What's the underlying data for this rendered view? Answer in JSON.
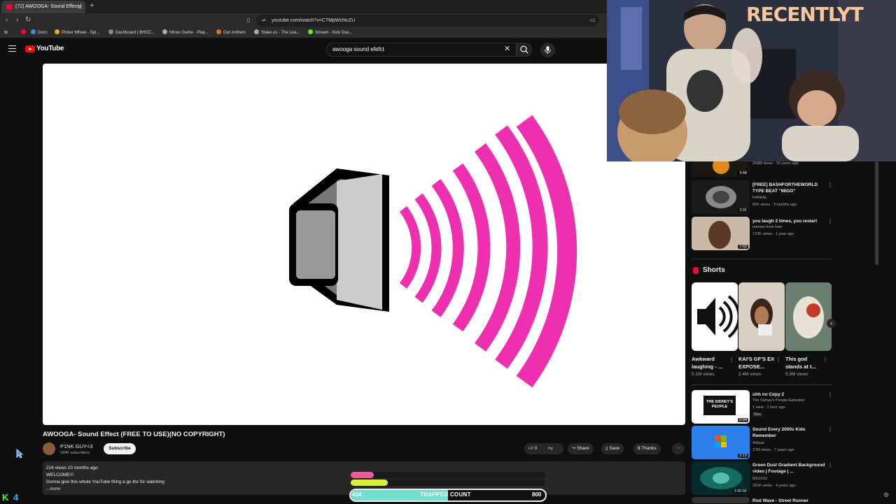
{
  "browser": {
    "tab_title": "(72) AWOOGA- Sound Effect (",
    "url": "youtube.com/watch?v=CTMpWchicZU",
    "bookmarks": [
      "Docs",
      "Picker Wheel - Spi...",
      "Dashboard | BHCC...",
      "Mines Game - Play...",
      "Our Anthem",
      "Stake.us - The Lea...",
      "Stream - Kick Gas..."
    ]
  },
  "youtube": {
    "logo_text": "YouTube",
    "search_value": "awooga sound efefct"
  },
  "video": {
    "title": "AWOOGA- Sound Effect (FREE TO USE)(NO COPYRIGHT)",
    "channel": "P1NK GUY<3",
    "subscribers": "184K subscribers",
    "subscribe_label": "Subscribe",
    "likes": "0",
    "share_label": "Share",
    "save_label": "Save",
    "thanks_label": "Thanks",
    "description": {
      "stats": "216 views  10 months ago",
      "line1": "WELCOME!!!",
      "line2": "Gonna give this whole YouTube thing a go thx for watching",
      "more": "...more"
    }
  },
  "overlay": {
    "brand_text": "RECENTLYT",
    "trapped_left": "414",
    "trapped_label": "TRAPPED COUNT",
    "trapped_right": "800",
    "bar1_fraction": 0.12,
    "bar2_fraction": 0.19,
    "trapped_fraction": 0.5
  },
  "sidebar": {
    "videos": [
      {
        "title": "",
        "meta1": "269M views · 10 years ago",
        "meta2": "",
        "duration": "3:48"
      },
      {
        "title": "[FREE] BASHFORTHEWORLD TYPE BEAT \"MIGO\"",
        "meta1": "K4REAL",
        "meta2": "65K views · 3 months ago",
        "duration": "2:31"
      },
      {
        "title": "you laugh 2 times, you restart",
        "meta1": "memes from hole",
        "meta2": "170K views · 1 year ago",
        "duration": "7:03"
      }
    ],
    "shorts_heading": "Shorts",
    "shorts": [
      {
        "title": "Awkward laughing - ...",
        "views": "5.1M views"
      },
      {
        "title": "KAI'S GF'S EX EXPOSE...",
        "views": "2.4M views"
      },
      {
        "title": "This god stands at t...",
        "views": "5.9M views"
      }
    ],
    "more_videos": [
      {
        "title": "uhh no   Copy 2",
        "meta1": "The Sidney's People Episodes",
        "meta2": "1 view · 1 hour ago",
        "badge": "New",
        "duration": "0:04"
      },
      {
        "title": "Sound Every 2000s Kids Remember",
        "meta1": "Artisax",
        "meta2": "27M views · 7 years ago",
        "duration": "2:13"
      },
      {
        "title": "Green Dust Gradient Background video | Footage | ...",
        "meta1": "MG1010",
        "meta2": "251K views · 4 years ago",
        "duration": "1:00:02"
      },
      {
        "title": "Rod Wave - Street Runner",
        "meta1": "",
        "meta2": "",
        "duration": ""
      }
    ],
    "thumb_text_sidney": "THE SIDNEY'S PEOPLE"
  },
  "colors": {
    "youtube_red": "#ff0000",
    "speaker_pink": "#ee2fb0",
    "bar_pink": "#f05a9a",
    "bar_yellow": "#d8f03a",
    "trap_teal": "#6fe0cc"
  }
}
